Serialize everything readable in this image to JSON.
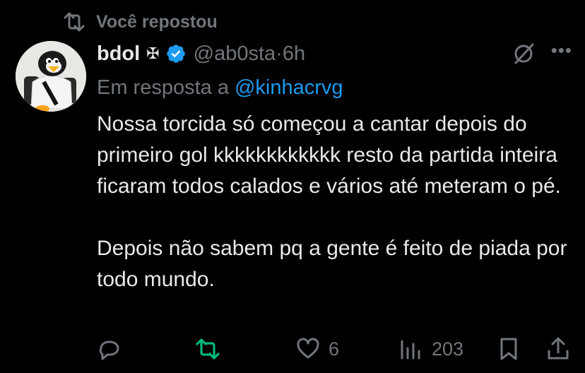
{
  "repost": {
    "label": "Você repostou",
    "icon": "repost-icon"
  },
  "author": {
    "name": "bdol",
    "name_symbol": "✠",
    "handle": "@ab0sta",
    "separator": " · ",
    "time": "6h",
    "verified": true
  },
  "reply": {
    "prefix": "Em resposta a",
    "mention": "@kinhacrvg"
  },
  "tweet": {
    "paragraph1": "Nossa torcida só começou a cantar depois do primeiro gol kkkkkkkkkkkk resto da partida inteira ficaram todos calados e vários até meteram o pé.",
    "paragraph2": "Depois não sabem pq a gente é feito de piada por todo mundo."
  },
  "actions": {
    "likes": "6",
    "views": "203"
  },
  "colors": {
    "background": "#000000",
    "text": "#e7e9ea",
    "muted": "#71767b",
    "link": "#1d9bf0",
    "repost_active": "#00ba7c"
  },
  "header_icons": {
    "grok": "grok-icon",
    "more": "more-icon"
  }
}
